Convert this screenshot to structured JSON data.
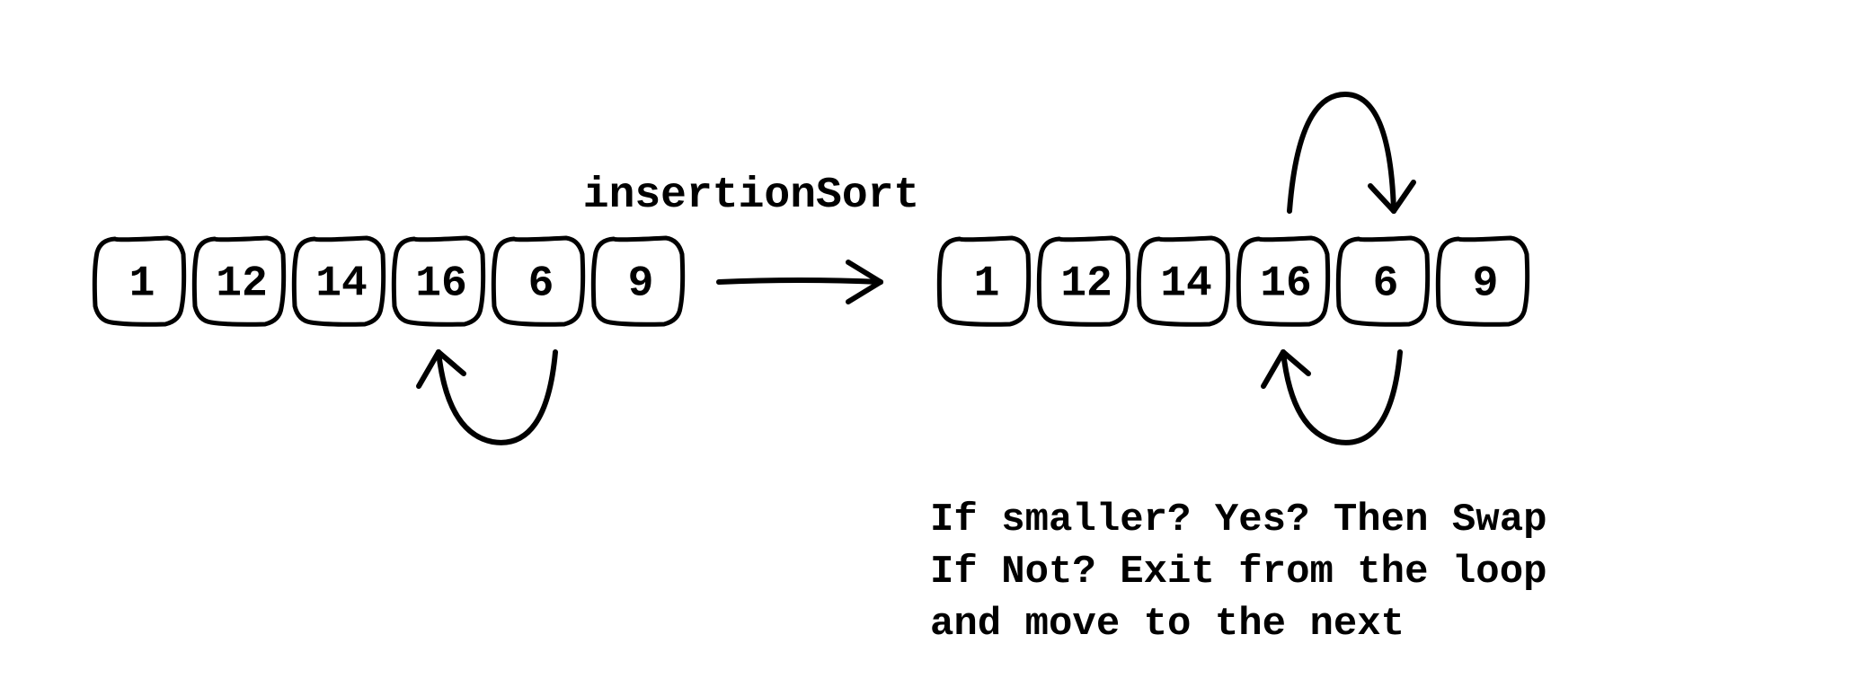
{
  "title": "insertionSort",
  "left_array": [
    "1",
    "12",
    "14",
    "16",
    "6",
    "9"
  ],
  "right_array": [
    "1",
    "12",
    "14",
    "16",
    "6",
    "9"
  ],
  "description": {
    "line1": "If smaller? Yes? Then Swap",
    "line2": "If Not? Exit from the loop",
    "line3": "and move to the next"
  }
}
